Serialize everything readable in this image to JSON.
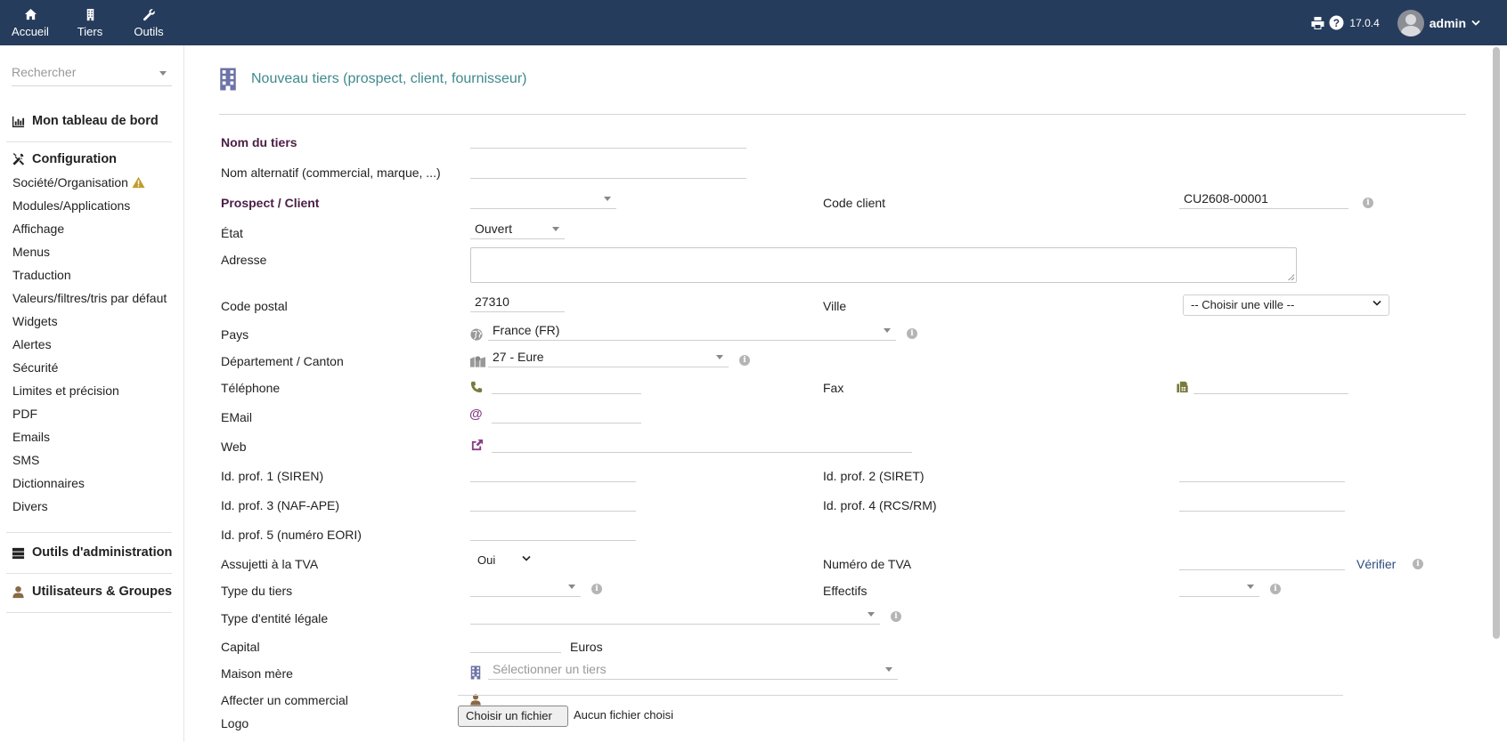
{
  "topbar": {
    "nav": [
      {
        "label": "Accueil",
        "icon": "home-icon"
      },
      {
        "label": "Tiers",
        "icon": "building-icon"
      },
      {
        "label": "Outils",
        "icon": "wrench-icon"
      }
    ],
    "version": "17.0.4",
    "user": "admin",
    "bg_color": "#263c5c"
  },
  "sidebar": {
    "search_placeholder": "Rechercher",
    "dashboard": "Mon tableau de bord",
    "configuration": "Configuration",
    "config_items": [
      "Société/Organisation",
      "Modules/Applications",
      "Affichage",
      "Menus",
      "Traduction",
      "Valeurs/filtres/tris par défaut",
      "Widgets",
      "Alertes",
      "Sécurité",
      "Limites et précision",
      "PDF",
      "Emails",
      "SMS",
      "Dictionnaires",
      "Divers"
    ],
    "admin_tools": "Outils d'administration",
    "users_groups": "Utilisateurs & Groupes"
  },
  "page": {
    "title": "Nouveau tiers (prospect, client, fournisseur)"
  },
  "form": {
    "name_label": "Nom du tiers",
    "alt_name_label": "Nom alternatif (commercial, marque, ...)",
    "prospect_label": "Prospect / Client",
    "client_code_label": "Code client",
    "client_code_value": "CU2608-00001",
    "state_label": "État",
    "state_value": "Ouvert",
    "address_label": "Adresse",
    "zip_label": "Code postal",
    "zip_value": "27310",
    "city_label": "Ville",
    "city_value": "-- Choisir une ville --",
    "country_label": "Pays",
    "country_value": "France (FR)",
    "department_label": "Département / Canton",
    "department_value": "27 - Eure",
    "phone_label": "Téléphone",
    "fax_label": "Fax",
    "email_label": "EMail",
    "web_label": "Web",
    "prof1_label": "Id. prof. 1 (SIREN)",
    "prof2_label": "Id. prof. 2 (SIRET)",
    "prof3_label": "Id. prof. 3 (NAF-APE)",
    "prof4_label": "Id. prof. 4 (RCS/RM)",
    "prof5_label": "Id. prof. 5 (numéro EORI)",
    "vat_subject_label": "Assujetti à la TVA",
    "vat_subject_value": "Oui",
    "vat_number_label": "Numéro de TVA",
    "verify_link": "Vérifier",
    "type_label": "Type du tiers",
    "staff_label": "Effectifs",
    "legal_entity_label": "Type d'entité légale",
    "capital_label": "Capital",
    "capital_unit": "Euros",
    "parent_label": "Maison mère",
    "parent_placeholder": "Sélectionner un tiers",
    "sales_rep_label": "Affecter un commercial",
    "logo_label": "Logo",
    "file_button": "Choisir un fichier",
    "file_none": "Aucun fichier choisi"
  }
}
